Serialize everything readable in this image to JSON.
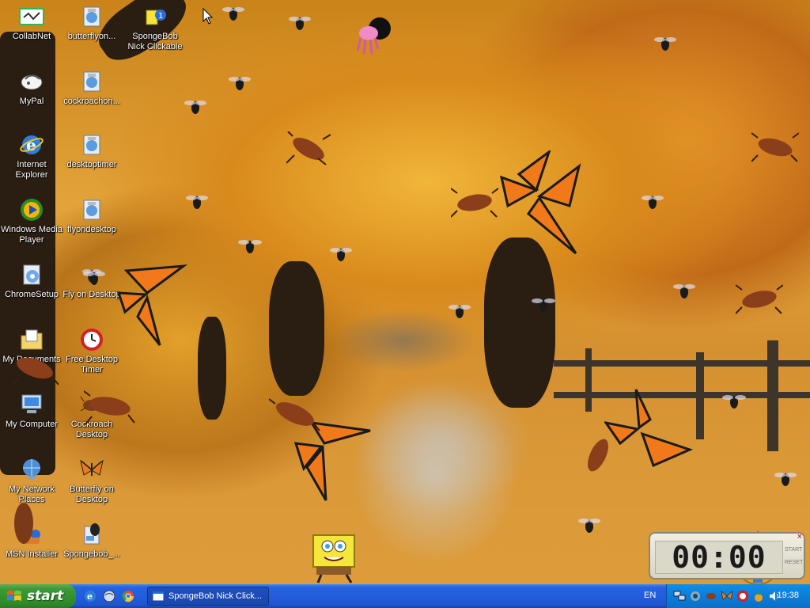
{
  "desktop_icons": [
    {
      "label": "CollabNet",
      "icon": "collabnet-icon"
    },
    {
      "label": "butterflyon...",
      "icon": "setup-icon"
    },
    {
      "label": "SpongeBob\nNick Clickable",
      "icon": "spongebob-icon"
    },
    {
      "label": "MyPal",
      "icon": "mypal-icon"
    },
    {
      "label": "cockroachon...",
      "icon": "setup-icon"
    },
    {
      "label": "Internet\nExplorer",
      "icon": "internet-explorer-icon"
    },
    {
      "label": "desktoptimer",
      "icon": "setup-icon"
    },
    {
      "label": "Windows Media\nPlayer",
      "icon": "windows-media-player-icon"
    },
    {
      "label": "flyondesktop",
      "icon": "setup-icon"
    },
    {
      "label": "ChromeSetup",
      "icon": "chrome-setup-icon"
    },
    {
      "label": "Fly on Desktop",
      "icon": "fly-icon"
    },
    {
      "label": "My Documents",
      "icon": "my-documents-icon"
    },
    {
      "label": "Free Desktop\nTimer",
      "icon": "timer-icon"
    },
    {
      "label": "My Computer",
      "icon": "my-computer-icon"
    },
    {
      "label": "Cockroach\nDesktop",
      "icon": "cockroach-icon"
    },
    {
      "label": "My Network\nPlaces",
      "icon": "my-network-places-icon"
    },
    {
      "label": "Butterfly on\nDesktop",
      "icon": "butterfly-icon"
    },
    {
      "label": "MSN Installer",
      "icon": "msn-installer-icon"
    },
    {
      "label": "Spongebob_...",
      "icon": "spongebob-installer-icon"
    }
  ],
  "timer": {
    "display": "00:00",
    "start_label": "START",
    "reset_label": "RESET",
    "close_label": "×"
  },
  "taskbar": {
    "start_label": "start",
    "quick_launch": [
      "internet-explorer-icon",
      "mypal-icon",
      "chrome-icon"
    ],
    "active_task": "SpongeBob Nick Click...",
    "language": "EN",
    "tray_icons": [
      "network-icon",
      "flyondesktop-tray-icon",
      "cockroach-tray-icon",
      "butterfly-tray-icon",
      "timer-tray-icon",
      "pineapple-tray-icon",
      "volume-icon"
    ],
    "clock": "19:38"
  },
  "colors": {
    "taskbar_blue": "#235ddc",
    "start_green": "#3c9a35",
    "tray_blue": "#0c7dd9",
    "butterfly_orange": "#f07a1a"
  }
}
